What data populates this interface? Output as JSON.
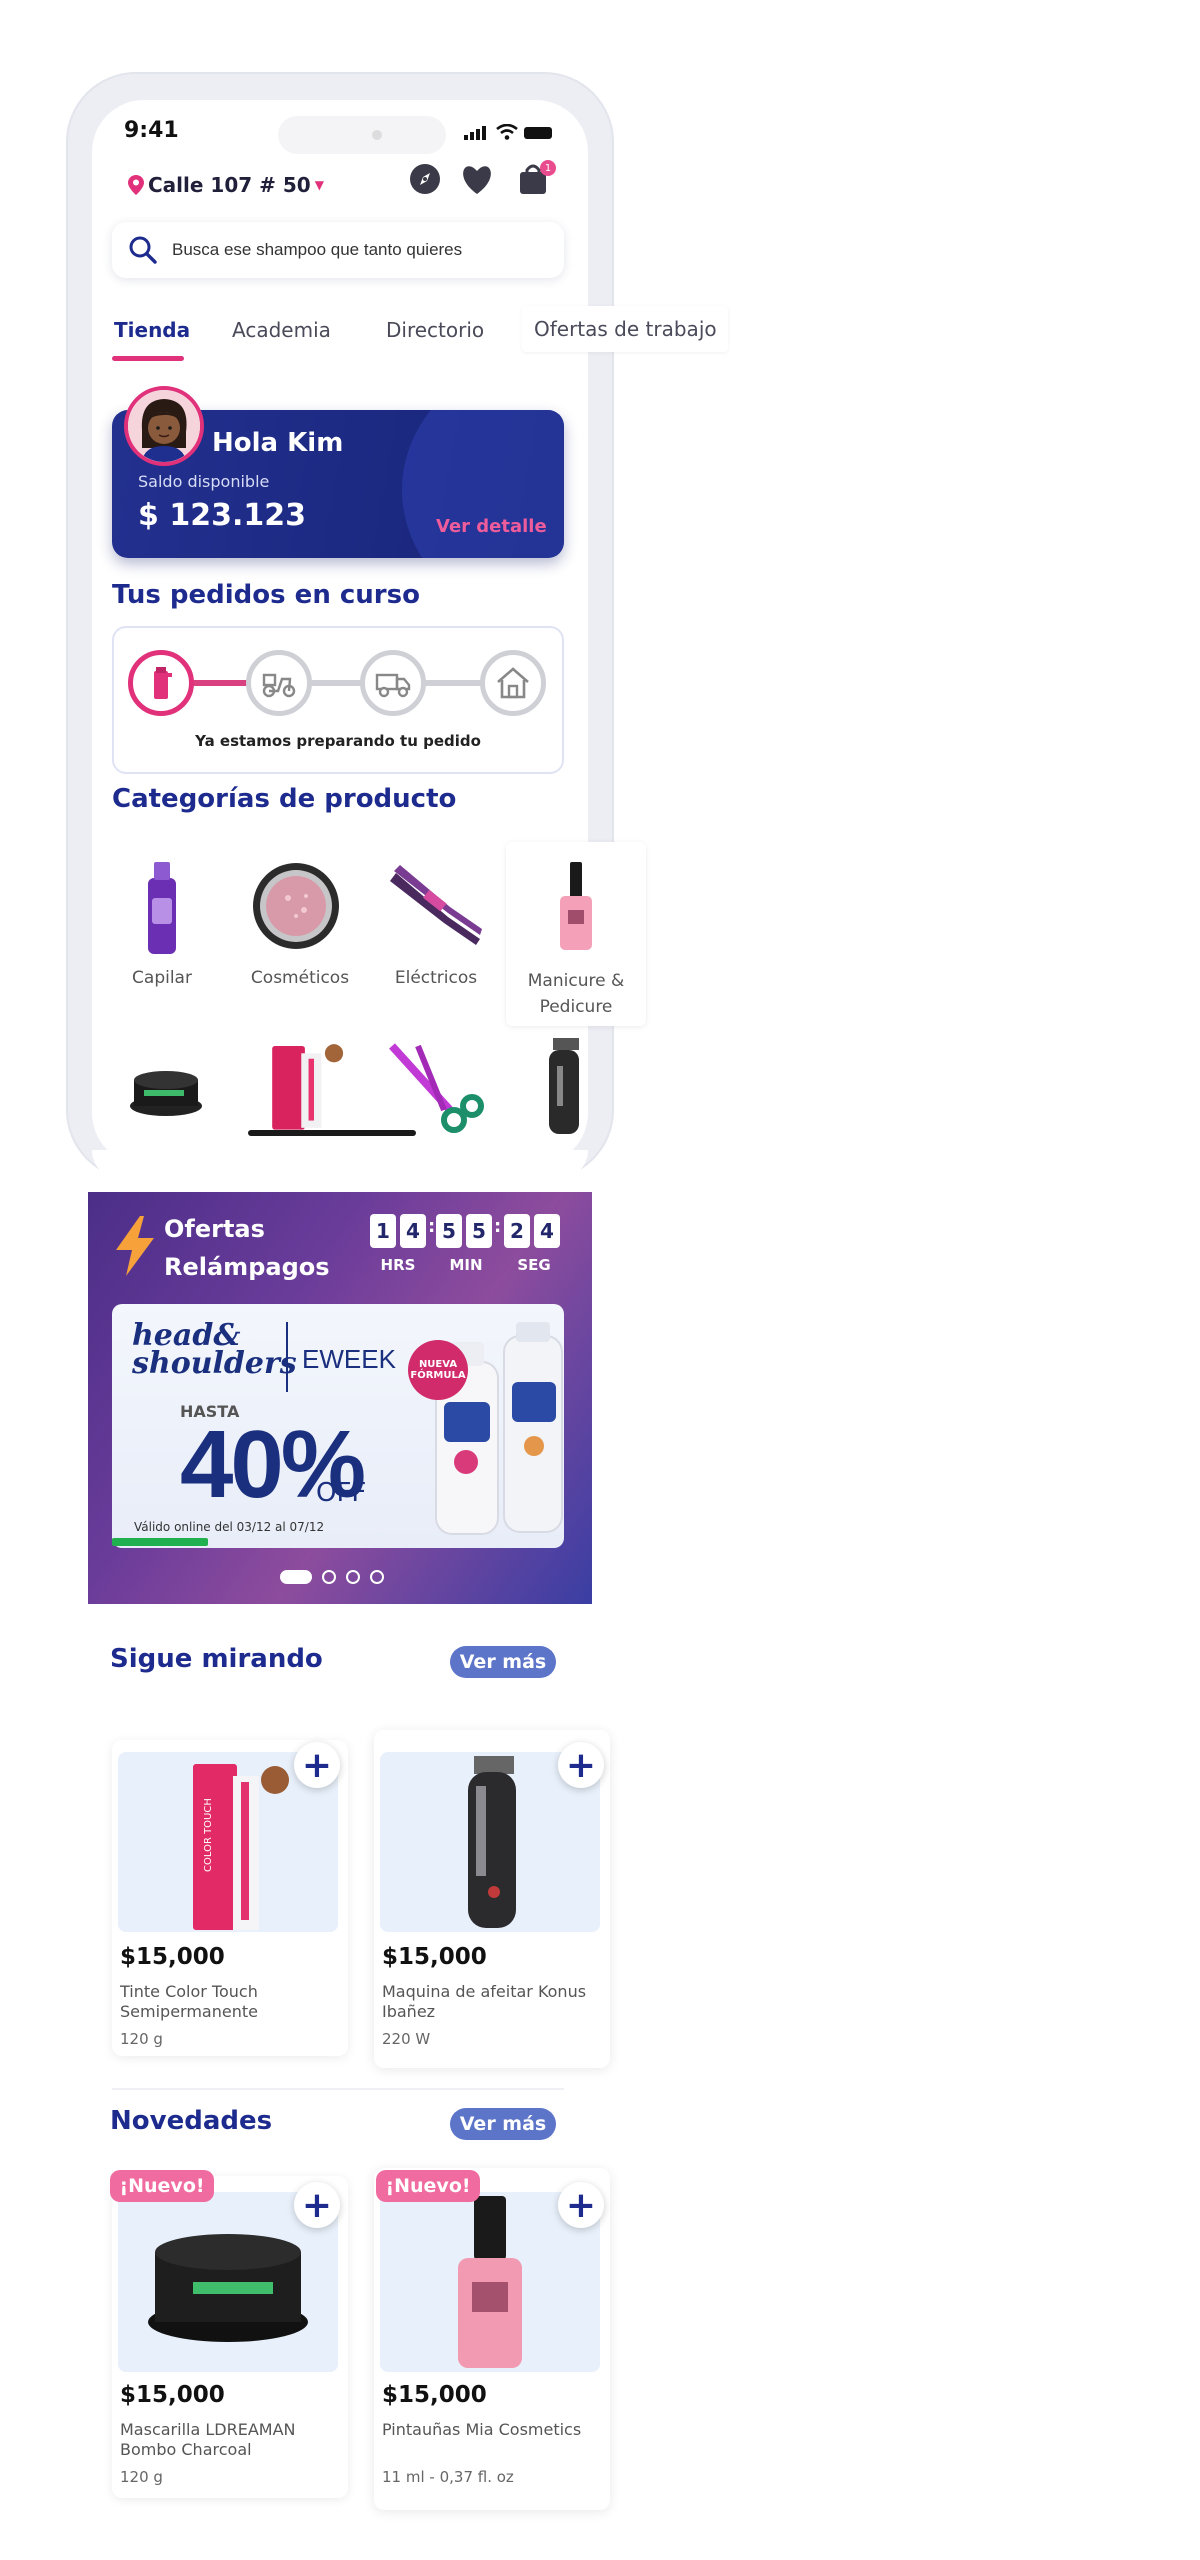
{
  "status_bar": {
    "time": "9:41"
  },
  "header": {
    "address": "Calle 107 # 50",
    "cart_count": "1"
  },
  "search": {
    "placeholder": "Busca ese shampoo que tanto quieres"
  },
  "tabs": [
    {
      "label": "Tienda",
      "active": true
    },
    {
      "label": "Academia"
    },
    {
      "label": "Directorio"
    },
    {
      "label": "Ofertas de trabajo"
    }
  ],
  "balance": {
    "greeting": "Hola Kim",
    "label": "Saldo disponible",
    "amount": "$ 123.123",
    "action": "Ver detalle"
  },
  "orders": {
    "title": "Tus pedidos en curso",
    "status": "Ya estamos preparando tu pedido"
  },
  "categories": {
    "title": "Categorías de producto",
    "items": [
      {
        "label": "Capilar",
        "icon": "shampoo-bottle-icon"
      },
      {
        "label": "Cosméticos",
        "icon": "compact-powder-icon"
      },
      {
        "label": "Eléctricos",
        "icon": "hair-straightener-icon"
      },
      {
        "label": "Manicure & Pedicure",
        "icon": "nail-polish-icon"
      }
    ],
    "row2_icons": [
      "charcoal-mask-jar-icon",
      "hair-dye-tube-icon",
      "scissors-icon",
      "hair-clipper-icon"
    ]
  },
  "flash_sale": {
    "title": "Ofertas Relámpagos",
    "digits": [
      "1",
      "4",
      "5",
      "5",
      "2",
      "4"
    ],
    "units": [
      "HRS",
      "MIN",
      "SEG"
    ],
    "banner": {
      "brand_line1": "head&",
      "brand_line2": "shoulders",
      "event": "EWEEK",
      "badge": "NUEVA FÓRMULA",
      "up_to": "HASTA",
      "percent": "40%",
      "off": "OFF",
      "validity": "Válido online del 03/12 al 07/12"
    },
    "slides": 4,
    "active_slide": 0
  },
  "keep_looking": {
    "title": "Sigue mirando",
    "action": "Ver más",
    "products": [
      {
        "price": "$15,000",
        "name": "Tinte Color Touch Semipermanente",
        "qty": "120 g"
      },
      {
        "price": "$15,000",
        "name": "Maquina de afeitar Konus Ibañez",
        "qty": "220 W"
      }
    ]
  },
  "new_items": {
    "title": "Novedades",
    "action": "Ver más",
    "badge": "¡Nuevo!",
    "products": [
      {
        "price": "$15,000",
        "name": "Mascarilla LDREAMAN Bombo Charcoal",
        "qty": "120 g"
      },
      {
        "price": "$15,000",
        "name": "Pintauñas Mia Cosmetics",
        "qty": "11 ml - 0,37 fl. oz"
      }
    ]
  },
  "colors": {
    "brand_blue": "#1d2b8f",
    "accent_pink": "#e0317a",
    "ver_mas_bg": "#5d75c8"
  }
}
